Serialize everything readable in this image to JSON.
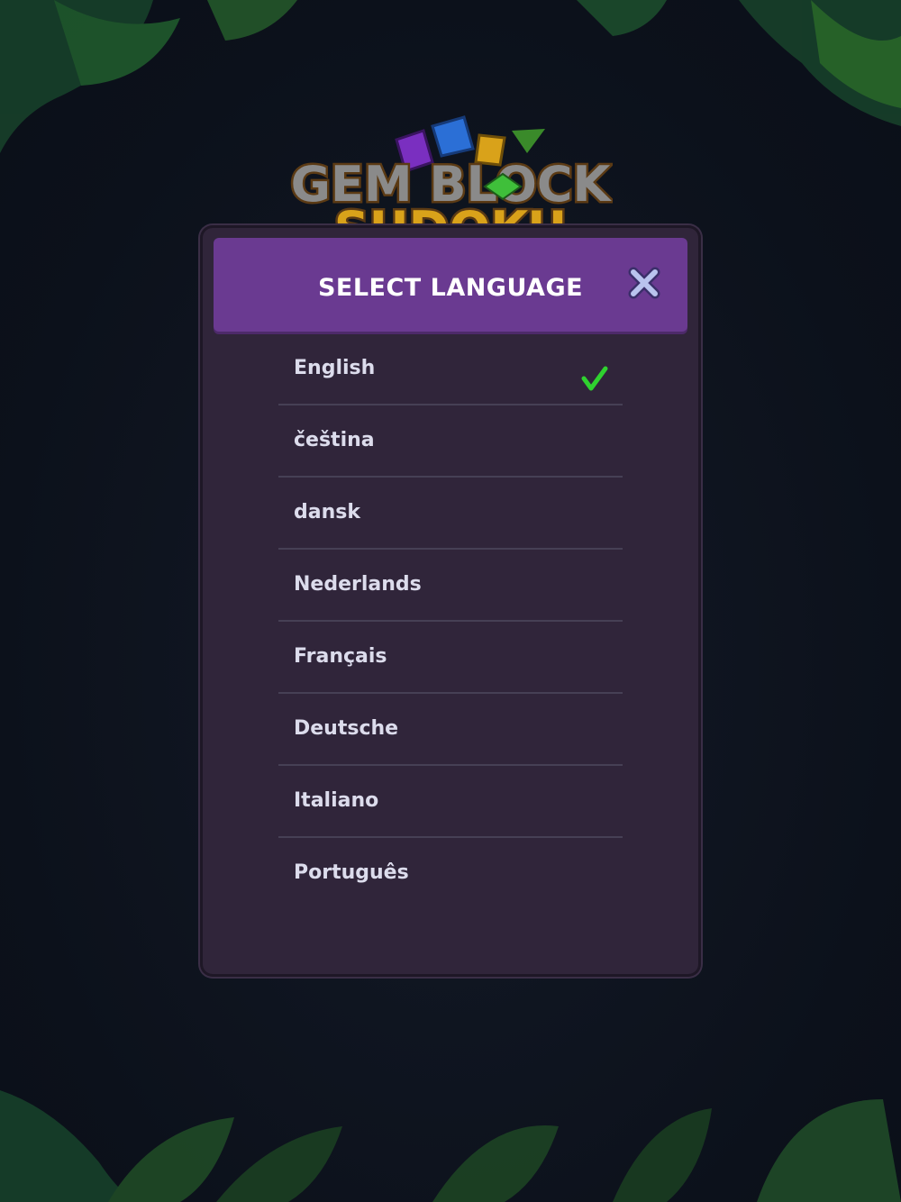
{
  "app": {
    "logo_line1": "GEM BLOCK",
    "logo_line2": "SUDOKU"
  },
  "modal": {
    "title": "SELECT LANGUAGE",
    "close_icon": "close-icon",
    "selected_icon": "checkmark-icon",
    "accent_color": "#6a3a91",
    "check_color": "#2fd12f"
  },
  "languages": [
    {
      "label": "English",
      "selected": true
    },
    {
      "label": "čeština",
      "selected": false
    },
    {
      "label": "dansk",
      "selected": false
    },
    {
      "label": "Nederlands",
      "selected": false
    },
    {
      "label": "Français",
      "selected": false
    },
    {
      "label": "Deutsche",
      "selected": false
    },
    {
      "label": "Italiano",
      "selected": false
    },
    {
      "label": "Português",
      "selected": false
    }
  ]
}
